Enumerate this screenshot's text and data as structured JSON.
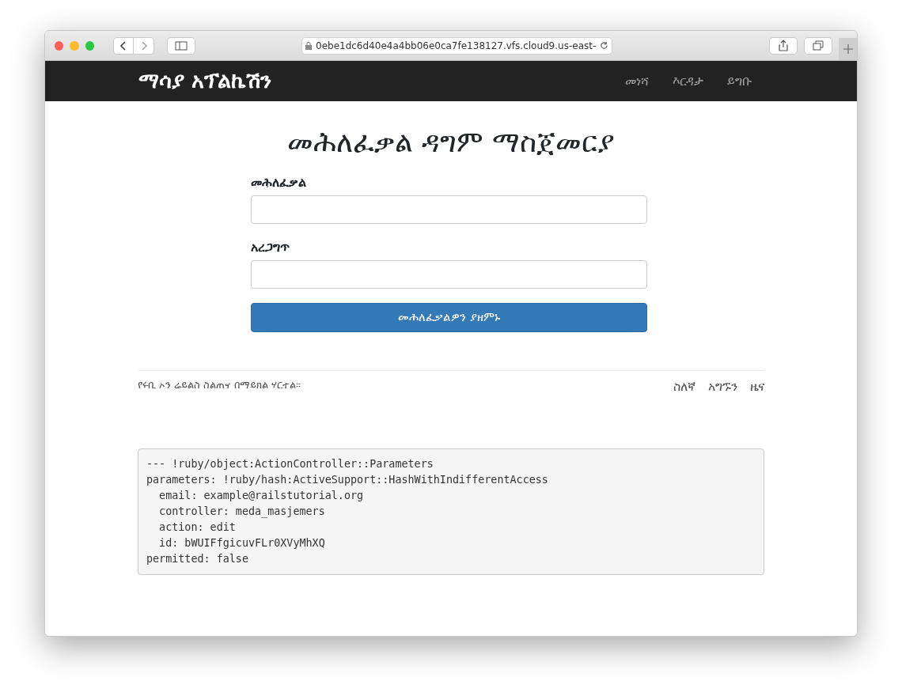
{
  "browser": {
    "url": "0ebe1dc6d40e4a4bb06e0ca7fe138127.vfs.cloud9.us-east-"
  },
  "navbar": {
    "brand": "ማሳያ አፕልኬሽን",
    "links": [
      "መነሻ",
      "እርዳታ",
      "ይግቡ"
    ]
  },
  "heading": "መሕለፈቃል ዳግም ማስጀመርያ",
  "form": {
    "fields": [
      {
        "label": "መሕለፈቃል"
      },
      {
        "label": "አረጋግጥ"
      }
    ],
    "submit": "መሕለፈቃልዎን ያዘምኑ"
  },
  "footer": {
    "text": "የሩቢ ኦን ሬይልስ ስልጠና በማይክል ሃርተል።",
    "links": [
      "ስለኛ",
      "አግኙን",
      "ዜና"
    ]
  },
  "debug": {
    "lines": [
      "--- !ruby/object:ActionController::Parameters",
      "parameters: !ruby/hash:ActiveSupport::HashWithIndifferentAccess",
      "  email: example@railstutorial.org",
      "  controller: meda_masjemers",
      "  action: edit",
      "  id: bWUIFfgicuvFLr0XVyMhXQ",
      "permitted: false"
    ]
  }
}
